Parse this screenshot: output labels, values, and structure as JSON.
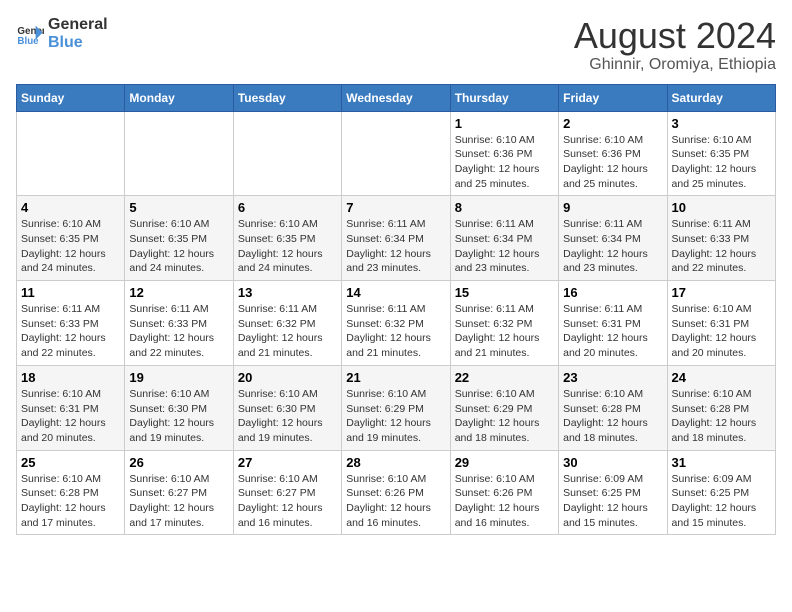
{
  "logo": {
    "line1": "General",
    "line2": "Blue"
  },
  "title": "August 2024",
  "subtitle": "Ghinnir, Oromiya, Ethiopia",
  "days_of_week": [
    "Sunday",
    "Monday",
    "Tuesday",
    "Wednesday",
    "Thursday",
    "Friday",
    "Saturday"
  ],
  "weeks": [
    [
      {
        "day": "",
        "info": ""
      },
      {
        "day": "",
        "info": ""
      },
      {
        "day": "",
        "info": ""
      },
      {
        "day": "",
        "info": ""
      },
      {
        "day": "1",
        "info": "Sunrise: 6:10 AM\nSunset: 6:36 PM\nDaylight: 12 hours and 25 minutes."
      },
      {
        "day": "2",
        "info": "Sunrise: 6:10 AM\nSunset: 6:36 PM\nDaylight: 12 hours and 25 minutes."
      },
      {
        "day": "3",
        "info": "Sunrise: 6:10 AM\nSunset: 6:35 PM\nDaylight: 12 hours and 25 minutes."
      }
    ],
    [
      {
        "day": "4",
        "info": "Sunrise: 6:10 AM\nSunset: 6:35 PM\nDaylight: 12 hours and 24 minutes."
      },
      {
        "day": "5",
        "info": "Sunrise: 6:10 AM\nSunset: 6:35 PM\nDaylight: 12 hours and 24 minutes."
      },
      {
        "day": "6",
        "info": "Sunrise: 6:10 AM\nSunset: 6:35 PM\nDaylight: 12 hours and 24 minutes."
      },
      {
        "day": "7",
        "info": "Sunrise: 6:11 AM\nSunset: 6:34 PM\nDaylight: 12 hours and 23 minutes."
      },
      {
        "day": "8",
        "info": "Sunrise: 6:11 AM\nSunset: 6:34 PM\nDaylight: 12 hours and 23 minutes."
      },
      {
        "day": "9",
        "info": "Sunrise: 6:11 AM\nSunset: 6:34 PM\nDaylight: 12 hours and 23 minutes."
      },
      {
        "day": "10",
        "info": "Sunrise: 6:11 AM\nSunset: 6:33 PM\nDaylight: 12 hours and 22 minutes."
      }
    ],
    [
      {
        "day": "11",
        "info": "Sunrise: 6:11 AM\nSunset: 6:33 PM\nDaylight: 12 hours and 22 minutes."
      },
      {
        "day": "12",
        "info": "Sunrise: 6:11 AM\nSunset: 6:33 PM\nDaylight: 12 hours and 22 minutes."
      },
      {
        "day": "13",
        "info": "Sunrise: 6:11 AM\nSunset: 6:32 PM\nDaylight: 12 hours and 21 minutes."
      },
      {
        "day": "14",
        "info": "Sunrise: 6:11 AM\nSunset: 6:32 PM\nDaylight: 12 hours and 21 minutes."
      },
      {
        "day": "15",
        "info": "Sunrise: 6:11 AM\nSunset: 6:32 PM\nDaylight: 12 hours and 21 minutes."
      },
      {
        "day": "16",
        "info": "Sunrise: 6:11 AM\nSunset: 6:31 PM\nDaylight: 12 hours and 20 minutes."
      },
      {
        "day": "17",
        "info": "Sunrise: 6:10 AM\nSunset: 6:31 PM\nDaylight: 12 hours and 20 minutes."
      }
    ],
    [
      {
        "day": "18",
        "info": "Sunrise: 6:10 AM\nSunset: 6:31 PM\nDaylight: 12 hours and 20 minutes."
      },
      {
        "day": "19",
        "info": "Sunrise: 6:10 AM\nSunset: 6:30 PM\nDaylight: 12 hours and 19 minutes."
      },
      {
        "day": "20",
        "info": "Sunrise: 6:10 AM\nSunset: 6:30 PM\nDaylight: 12 hours and 19 minutes."
      },
      {
        "day": "21",
        "info": "Sunrise: 6:10 AM\nSunset: 6:29 PM\nDaylight: 12 hours and 19 minutes."
      },
      {
        "day": "22",
        "info": "Sunrise: 6:10 AM\nSunset: 6:29 PM\nDaylight: 12 hours and 18 minutes."
      },
      {
        "day": "23",
        "info": "Sunrise: 6:10 AM\nSunset: 6:28 PM\nDaylight: 12 hours and 18 minutes."
      },
      {
        "day": "24",
        "info": "Sunrise: 6:10 AM\nSunset: 6:28 PM\nDaylight: 12 hours and 18 minutes."
      }
    ],
    [
      {
        "day": "25",
        "info": "Sunrise: 6:10 AM\nSunset: 6:28 PM\nDaylight: 12 hours and 17 minutes."
      },
      {
        "day": "26",
        "info": "Sunrise: 6:10 AM\nSunset: 6:27 PM\nDaylight: 12 hours and 17 minutes."
      },
      {
        "day": "27",
        "info": "Sunrise: 6:10 AM\nSunset: 6:27 PM\nDaylight: 12 hours and 16 minutes."
      },
      {
        "day": "28",
        "info": "Sunrise: 6:10 AM\nSunset: 6:26 PM\nDaylight: 12 hours and 16 minutes."
      },
      {
        "day": "29",
        "info": "Sunrise: 6:10 AM\nSunset: 6:26 PM\nDaylight: 12 hours and 16 minutes."
      },
      {
        "day": "30",
        "info": "Sunrise: 6:09 AM\nSunset: 6:25 PM\nDaylight: 12 hours and 15 minutes."
      },
      {
        "day": "31",
        "info": "Sunrise: 6:09 AM\nSunset: 6:25 PM\nDaylight: 12 hours and 15 minutes."
      }
    ]
  ]
}
